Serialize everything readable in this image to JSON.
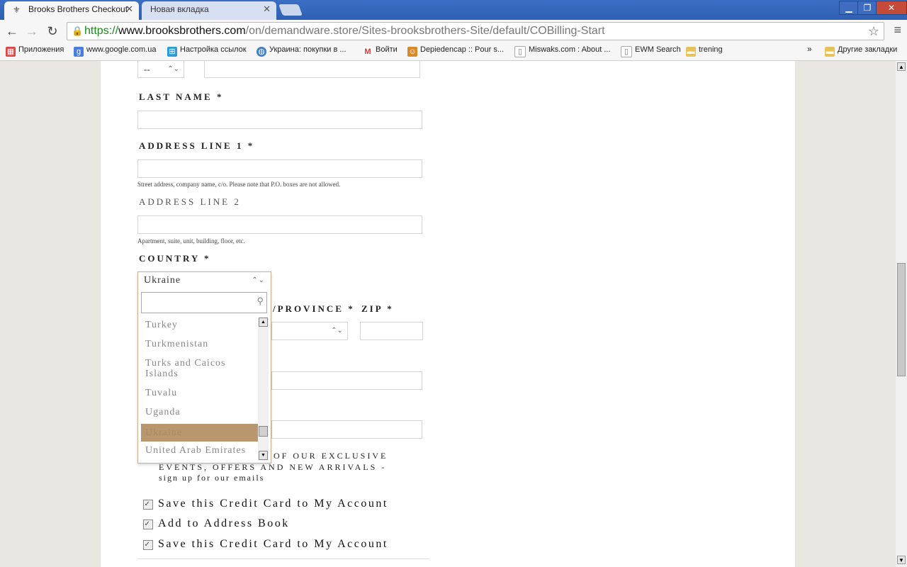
{
  "browser": {
    "tabs": [
      {
        "title": "Brooks Brothers Checkout",
        "active": true
      },
      {
        "title": "Новая вкладка",
        "active": false
      }
    ],
    "url": {
      "scheme": "https://",
      "host": "www.brooksbrothers.com",
      "path": "/on/demandware.store/Sites-brooksbrothers-Site/default/COBilling-Start"
    },
    "bookmarks": [
      {
        "label": "Приложения",
        "icon": "apps-grid-icon"
      },
      {
        "label": "www.google.com.ua",
        "icon": "google-icon"
      },
      {
        "label": "Настройка ссылок",
        "icon": "windows-icon"
      },
      {
        "label": "Украина: покупки в ...",
        "icon": "globe-icon"
      },
      {
        "label": "Войти",
        "icon": "gmail-icon"
      },
      {
        "label": "Depiedencap :: Pour s...",
        "icon": "person-icon"
      },
      {
        "label": "Miswaks.com : About ...",
        "icon": "page-icon"
      },
      {
        "label": "EWM Search",
        "icon": "page-icon"
      },
      {
        "label": "trening",
        "icon": "folder-icon"
      }
    ],
    "bookmarks_overflow": "»",
    "other_bookmarks": "Другие закладки"
  },
  "form": {
    "prefix_select_value": "--",
    "last_name_label": "LAST NAME *",
    "address1_label": "ADDRESS LINE 1 *",
    "address1_hint": "Street address, company name, c/o. Please note that P.O. boxes are not allowed.",
    "address2_label": "ADDRESS LINE 2",
    "address2_hint": "Apartment, suite, unit, building, floor, etc.",
    "country_label": "COUNTRY *",
    "country_value": "Ukraine",
    "state_label": "/PROVINCE *",
    "zip_label": "ZIP *",
    "newsletter_line1": "OF OUR EXCLUSIVE",
    "newsletter_line2": "EVENTS, OFFERS AND NEW ARRIVALS -",
    "newsletter_line3": "sign up for our emails",
    "checkboxes": [
      {
        "label": "Save this Credit Card to My Account",
        "checked": true
      },
      {
        "label": "Add to Address Book",
        "checked": true
      },
      {
        "label": "Save this Credit Card to My Account",
        "checked": true
      }
    ]
  },
  "country_dropdown": {
    "selected": "Ukraine",
    "search_placeholder": "",
    "options": [
      "Turkey",
      "Turkmenistan",
      "Turks and Caicos Islands",
      "Tuvalu",
      "Uganda",
      "Ukraine",
      "United Arab Emirates"
    ],
    "highlighted": "Ukraine"
  },
  "colors": {
    "accent_highlight": "#b9976e",
    "dropdown_border": "#c8b08c"
  }
}
